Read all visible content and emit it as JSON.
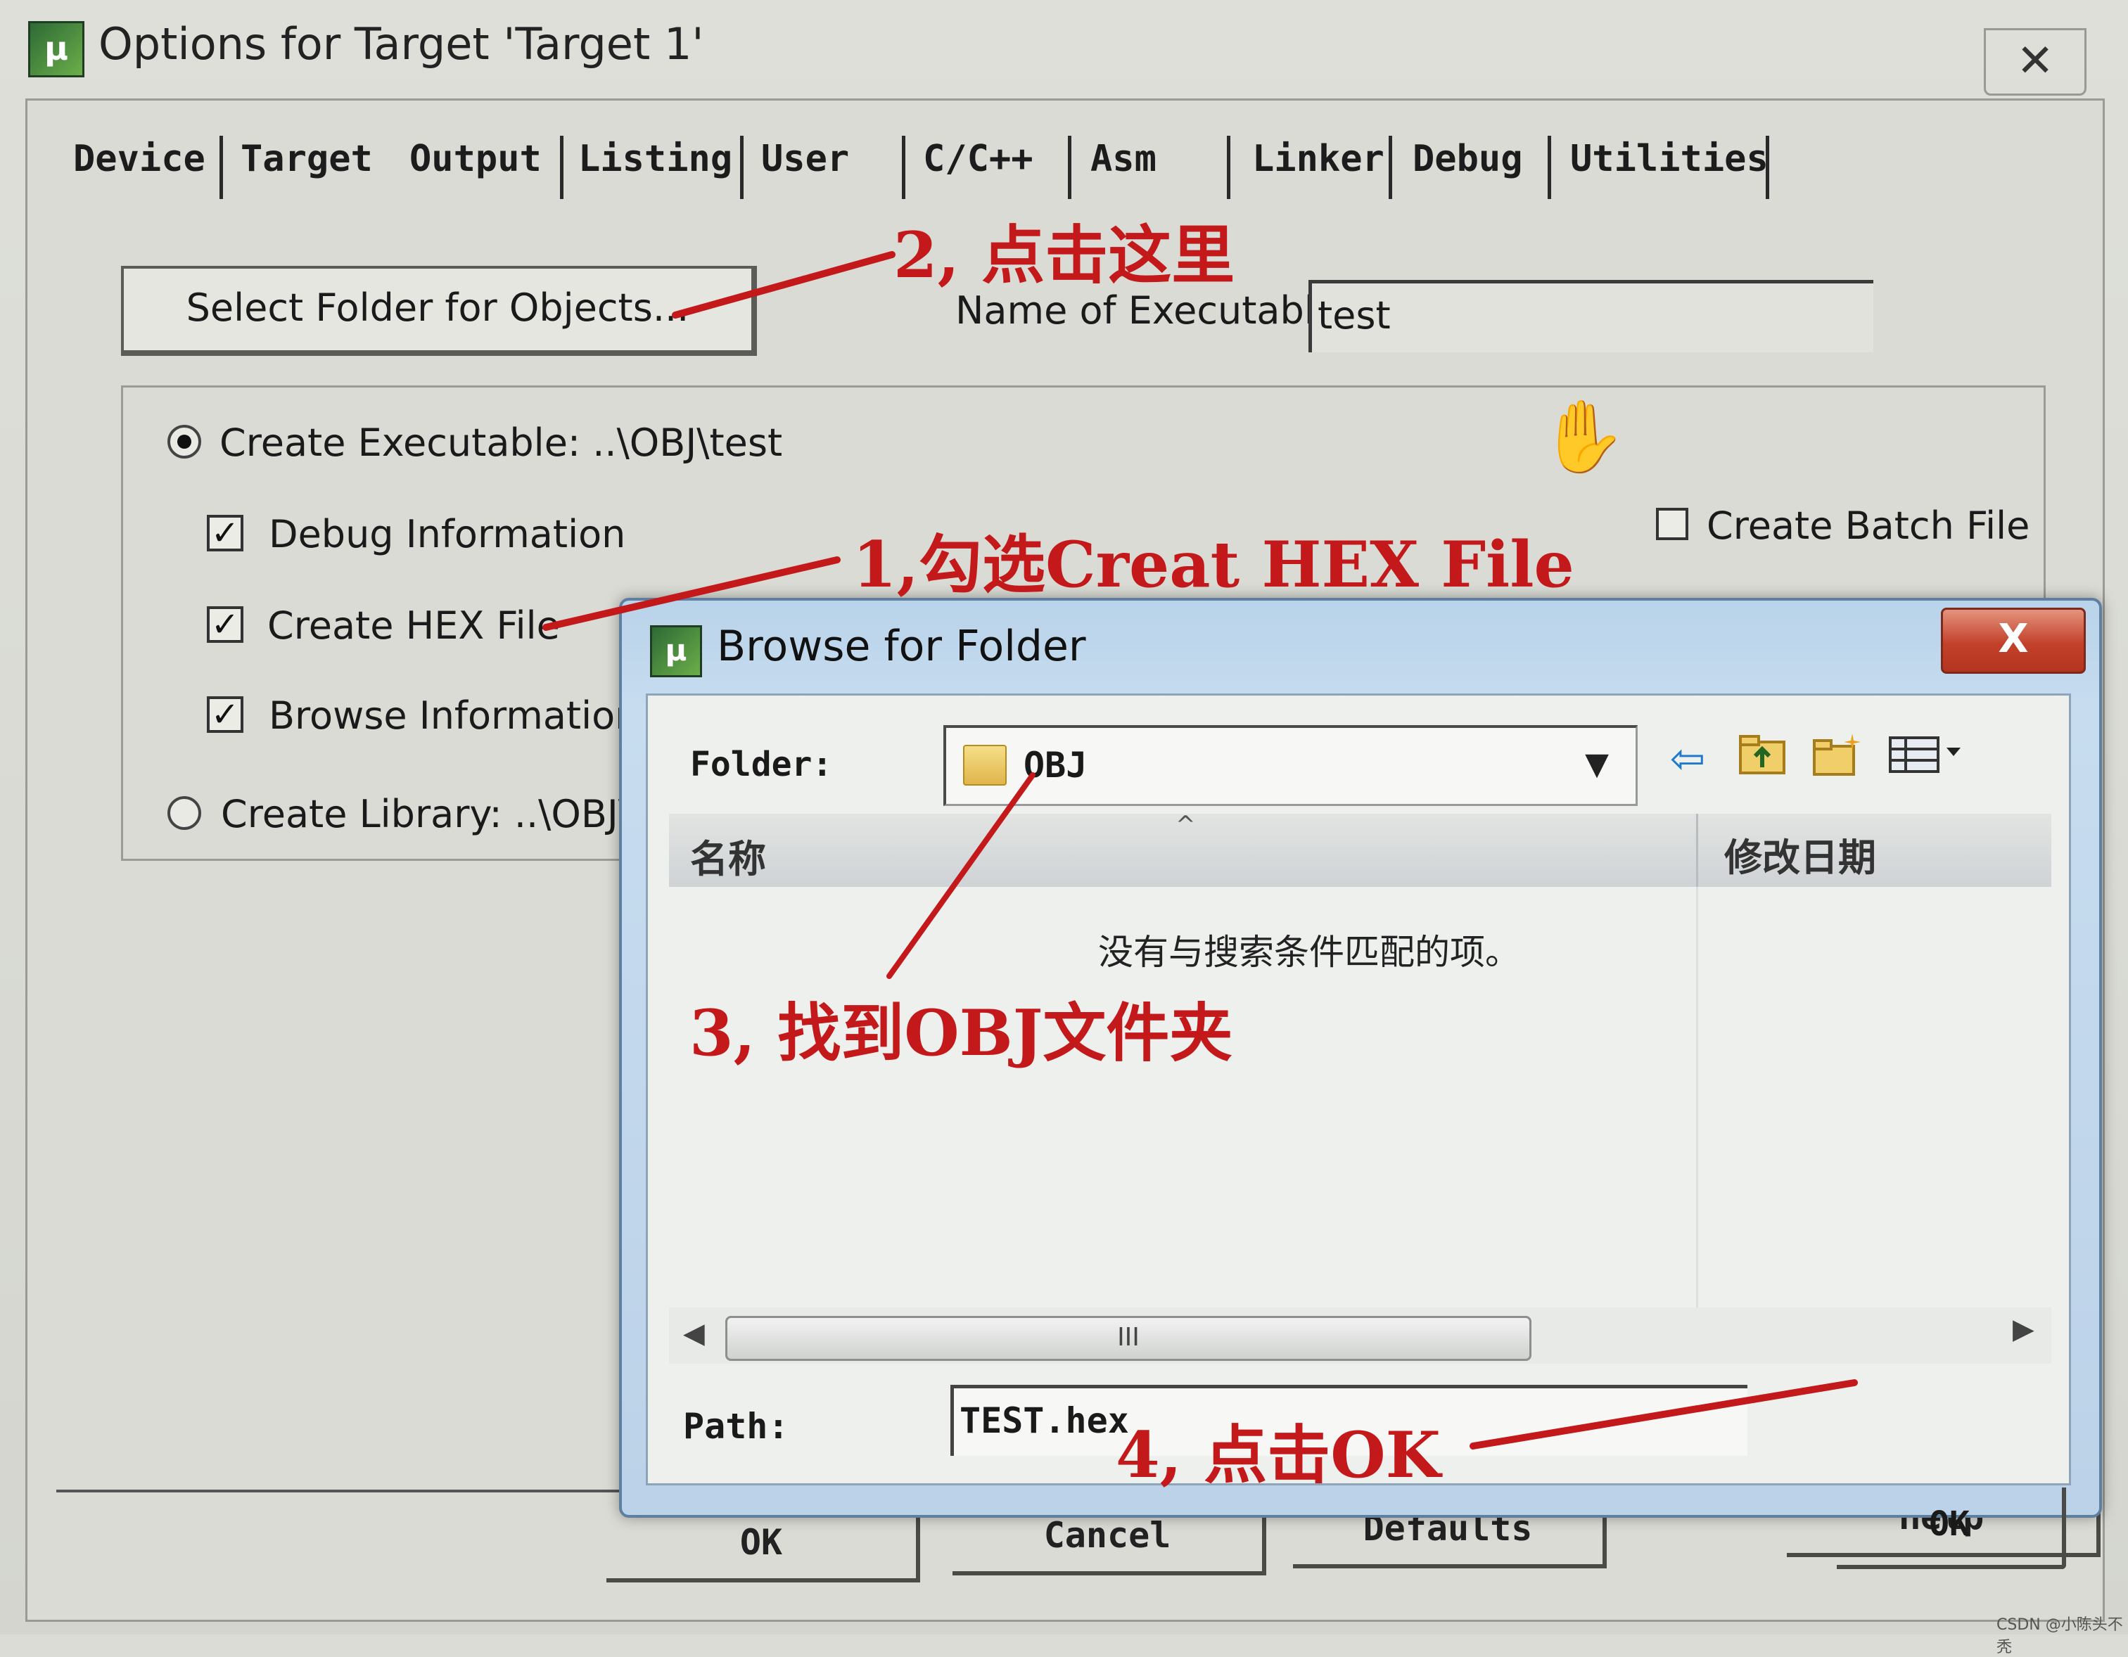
{
  "window": {
    "title": "Options for Target 'Target 1'",
    "icon": "keil-uvision-icon",
    "close": "✕"
  },
  "tabs": [
    {
      "label": "Device"
    },
    {
      "label": "Target"
    },
    {
      "label": "Output",
      "active": true
    },
    {
      "label": "Listing"
    },
    {
      "label": "User"
    },
    {
      "label": "C/C++"
    },
    {
      "label": "Asm"
    },
    {
      "label": "Linker"
    },
    {
      "label": "Debug"
    },
    {
      "label": "Utilities"
    }
  ],
  "output": {
    "select_folder_label": "Select Folder for Objects...",
    "exe_name_label": "Name of Executable:",
    "exe_name_value": "test",
    "create_executable_label": "Create Executable:  ..\\OBJ\\test",
    "create_executable_selected": true,
    "debug_info_label": "Debug Information",
    "debug_info_checked": true,
    "create_hex_label": "Create HEX File",
    "create_hex_checked": true,
    "browse_info_label": "Browse Information",
    "browse_info_checked": true,
    "create_library_label": "Create Library:  ..\\OBJ\\",
    "create_library_selected": false,
    "create_batch_label": "Create Batch File",
    "create_batch_checked": false
  },
  "bottom_buttons": {
    "ok": "OK",
    "cancel": "Cancel",
    "defaults": "Defaults",
    "help": "Help"
  },
  "browse_dialog": {
    "title": "Browse for Folder",
    "close": "X",
    "folder_label": "Folder:",
    "folder_value": "OBJ",
    "toolbar_icons": [
      "back-arrow-icon",
      "up-folder-icon",
      "new-folder-icon",
      "view-menu-icon"
    ],
    "col_name": "名称",
    "col_date": "修改日期",
    "empty_message": "没有与搜索条件匹配的项。",
    "scroll_thumb_grip": "III",
    "path_label": "Path:",
    "path_value": "TEST.hex",
    "ok_label": "OK"
  },
  "annotations": {
    "step1": "1,勾选Creat HEX File",
    "step2": "2, 点击这里",
    "step3": "3, 找到OBJ文件夹",
    "step4": "4, 点击OK",
    "color": "#c4191b"
  },
  "watermark": "CSDN @小陈头不秃"
}
